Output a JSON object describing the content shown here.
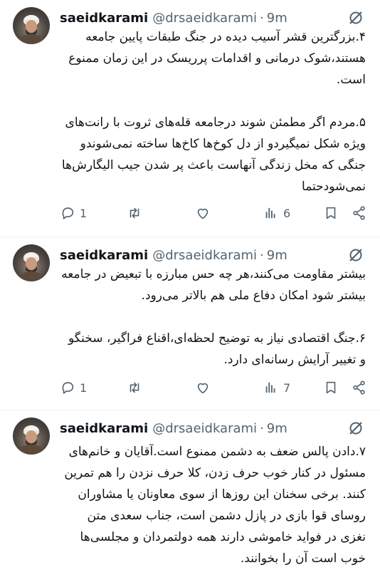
{
  "tweets": [
    {
      "username": "saeidkarami",
      "handle": "@drsaeidkarami",
      "separator": "·",
      "time": "9m",
      "text": "۴.بزرگترین قشر آسیب دیده در جنگ طبقات پایین جامعه هستند،شوک درمانی و اقدامات پرریسک در این زمان ممنوع است.\n\n۵.مردم اگر مطمئن شوند درجامعه قله‌های ثروت با رانت‌های ویژه شکل نمیگیردو از دل کوخ‌ها کاخ‌ها ساخته نمی‌شوندو جنگی که مخل زندگی آنهاست باعث پر شدن جیب الیگارش‌ها نمی‌شودحتما",
      "replies": "1",
      "views": "6"
    },
    {
      "username": "saeidkarami",
      "handle": "@drsaeidkarami",
      "separator": "·",
      "time": "9m",
      "text": "بیشتر مقاومت می‌کنند،هر چه حس مبارزه با تبعیض در جامعه بیشتر شود امکان دفاع ملی هم بالاتر می‌رود.\n\n۶.جنگ اقتصادی نیاز به توضیح لحظه‌ای،اقناع فراگیر، سخنگو و تغییر آرایش رسانه‌ای دارد.",
      "replies": "1",
      "views": "7"
    },
    {
      "username": "saeidkarami",
      "handle": "@drsaeidkarami",
      "separator": "·",
      "time": "9m",
      "text": "۷.دادن پالس ضعف به دشمن ممنوع است.آقایان و خانم‌های مسئول در کنار خوب حرف زدن، کلا حرف نزدن را هم تمرین کنند. برخی سخنان این روزها از سوی معاونان یا مشاوران روسای قوا بازی در پازل دشمن است، جناب سعدی متن نغزی در فواید خاموشی دارند همه دولتمردان و مجلسی‌ها خوب است آن را بخوانند."
    }
  ]
}
